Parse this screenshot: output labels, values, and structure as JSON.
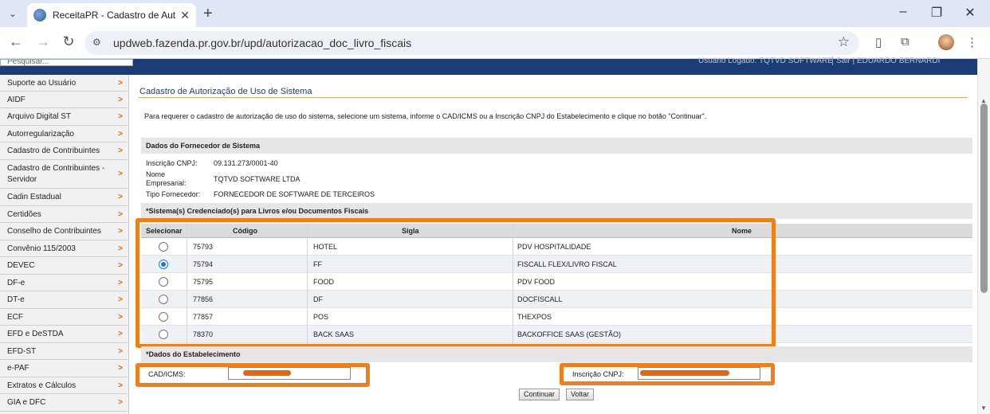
{
  "browser": {
    "tab_title": "ReceitaPR - Cadastro de Autoriz",
    "new_tab": "+",
    "url": "updweb.fazenda.pr.gov.br/upd/autorizacao_doc_livro_fiscais",
    "window_controls": [
      "–",
      "❐",
      "✕"
    ]
  },
  "header": {
    "search_placeholder": "Pesquisar...",
    "user_info": "Usuário Logado: TQTVD SOFTWARE",
    "user_info_2": "Sair | EDUARDO BERNARDI"
  },
  "sidebar": {
    "items": [
      {
        "label": "Suporte ao Usuário"
      },
      {
        "label": "AIDF"
      },
      {
        "label": "Arquivo Digital ST"
      },
      {
        "label": "Autorregularização"
      },
      {
        "label": "Cadastro de Contribuintes"
      },
      {
        "label": "Cadastro de Contribuintes - Servidor"
      },
      {
        "label": "Cadin Estadual"
      },
      {
        "label": "Certidões"
      },
      {
        "label": "Conselho de Contribuintes"
      },
      {
        "label": "Convênio 115/2003"
      },
      {
        "label": "DEVEC"
      },
      {
        "label": "DF-e"
      },
      {
        "label": "DT-e"
      },
      {
        "label": "ECF"
      },
      {
        "label": "EFD e DeSTDA"
      },
      {
        "label": "EFD-ST"
      },
      {
        "label": "e-PAF"
      },
      {
        "label": "Extratos e Cálculos"
      },
      {
        "label": "GIA e DFC"
      }
    ]
  },
  "main": {
    "title": "Cadastro de Autorização de Uso de Sistema",
    "instructions": "Para requerer o cadastro de autorização de uso do sistema, selecione um sistema, informe o CAD/ICMS ou a Inscrição CNPJ do Estabelecimento e clique no botão \"Continuar\".",
    "supplier_section": "Dados do Fornecedor de Sistema",
    "supplier": {
      "cnpj_label": "Inscrição CNPJ:",
      "cnpj_value": "09.131.273/0001-40",
      "name_label_1": "Nome",
      "name_label_2": "Empresarial:",
      "name_value": "TQTVD SOFTWARE LTDA",
      "type_label": "Tipo Fornecedor:",
      "type_value": "FORNECEDOR DE SOFTWARE DE TERCEIROS"
    },
    "systems_section": "*Sistema(s) Credenciado(s) para Livros e/ou Documentos Fiscais",
    "table": {
      "headers": [
        "Selecionar",
        "Código",
        "Sigla",
        "Nome"
      ],
      "rows": [
        {
          "codigo": "75793",
          "sigla": "HOTEL",
          "nome": "PDV HOSPITALIDADE",
          "selected": false
        },
        {
          "codigo": "75794",
          "sigla": "FF",
          "nome": "FISCALL FLEX/LIVRO FISCAL",
          "selected": true
        },
        {
          "codigo": "75795",
          "sigla": "FOOD",
          "nome": "PDV FOOD",
          "selected": false
        },
        {
          "codigo": "77856",
          "sigla": "DF",
          "nome": "DOCFISCALL",
          "selected": false
        },
        {
          "codigo": "77857",
          "sigla": "POS",
          "nome": "THEXPOS",
          "selected": false
        },
        {
          "codigo": "78370",
          "sigla": "BACK SAAS",
          "nome": "BACKOFFICE SAAS (GESTÃO)",
          "selected": false
        }
      ]
    },
    "establishment_section": "*Dados do Estabelecimento",
    "cad_label": "CAD/ICMS:",
    "cnpj_field_label": "Inscrição CNPJ:",
    "continue_button": "Continuar",
    "back_button": "Voltar"
  },
  "colors": {
    "highlight": "#f07e1b",
    "header_band": "#1b3d73",
    "sidebar_arrow": "#e06a00",
    "title": "#1f3f73"
  }
}
